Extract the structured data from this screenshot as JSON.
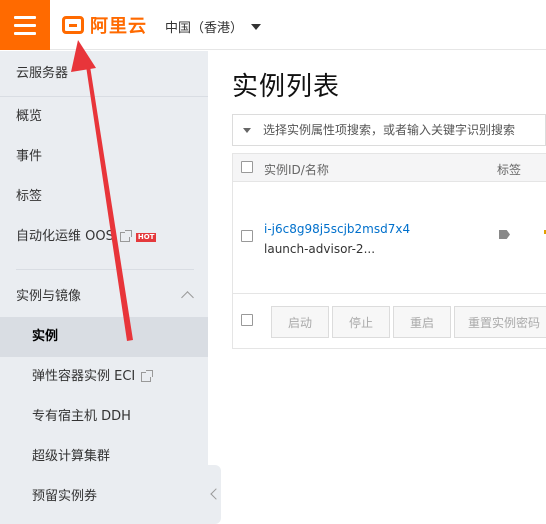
{
  "header": {
    "brand_text": "阿里云",
    "region_label": "中国（香港）"
  },
  "sidebar": {
    "title": "云服务器",
    "items": [
      {
        "label": "概览"
      },
      {
        "label": "事件"
      },
      {
        "label": "标签"
      },
      {
        "label": "自动化运维 OOS",
        "badge": "HOT"
      }
    ],
    "group": {
      "label": "实例与镜像",
      "items": [
        {
          "label": "实例",
          "active": true
        },
        {
          "label": "弹性容器实例 ECI"
        },
        {
          "label": "专有宿主机 DDH"
        },
        {
          "label": "超级计算集群"
        },
        {
          "label": "预留实例券"
        }
      ]
    }
  },
  "main": {
    "title": "实例列表",
    "search_placeholder": "选择实例属性项搜索，或者输入关键字识别搜索",
    "table": {
      "columns": [
        "实例ID/名称",
        "标签"
      ],
      "rows": [
        {
          "id": "i-j6c8g98j5scjb2msd7x4",
          "name": "launch-advisor-2..."
        }
      ],
      "actions": [
        "启动",
        "停止",
        "重启",
        "重置实例密码"
      ]
    }
  },
  "colors": {
    "brand": "#ff6a00",
    "link": "#0070cc",
    "annotation": "#e8353a"
  }
}
